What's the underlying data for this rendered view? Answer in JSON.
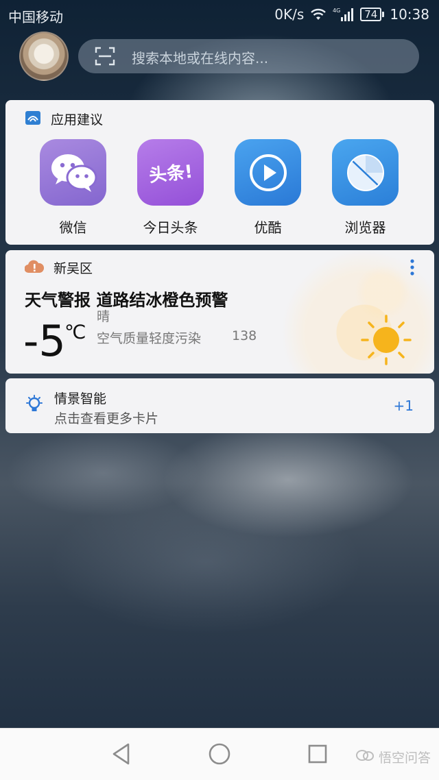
{
  "status_bar": {
    "carrier": "中国移动",
    "speed": "0K/s",
    "network_badge": "4G",
    "battery": "74",
    "time": "10:38"
  },
  "search": {
    "placeholder": "搜索本地或在线内容..."
  },
  "app_suggestions": {
    "title": "应用建议",
    "apps": [
      {
        "label": "微信",
        "icon": "wechat-icon"
      },
      {
        "label": "今日头条",
        "icon": "toutiao-icon",
        "badge_text": "头条!"
      },
      {
        "label": "优酷",
        "icon": "youku-icon"
      },
      {
        "label": "浏览器",
        "icon": "browser-icon"
      }
    ]
  },
  "weather": {
    "location": "新吴区",
    "alert": "天气警报 道路结冰橙色预警",
    "temperature": "-5",
    "unit": "℃",
    "condition": "晴",
    "aqi_label": "空气质量轻度污染",
    "aqi_value": "138"
  },
  "scene": {
    "title": "情景智能",
    "subtitle": "点击查看更多卡片",
    "count": "+1"
  },
  "watermark": "悟空问答",
  "colors": {
    "accent_blue": "#2d77d6",
    "card_bg": "#f3f3f5",
    "weather_icon": "#e08e63",
    "sun": "#f6b41c"
  }
}
